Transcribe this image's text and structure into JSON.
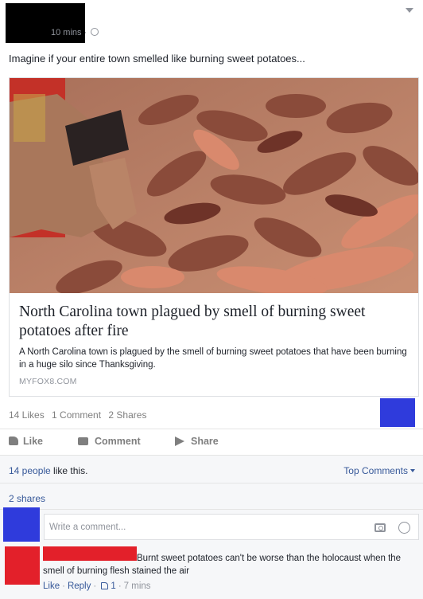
{
  "post": {
    "time": "10 mins",
    "text": "Imagine if your entire town smelled like burning sweet potatoes..."
  },
  "link": {
    "title": "North Carolina town plagued by smell of burning sweet potatoes after fire",
    "description": "A North Carolina town is plagued by the smell of burning sweet potatoes that have been burning in a huge silo since Thanksgiving.",
    "source": "MYFOX8.COM"
  },
  "stats": {
    "likes": "14 Likes",
    "comments": "1 Comment",
    "shares": "2 Shares"
  },
  "actions": {
    "like": "Like",
    "comment": "Comment",
    "share": "Share"
  },
  "summary": {
    "people_link": "14 people",
    "people_rest": " like this.",
    "top_comments": "Top Comments",
    "shares": "2 shares"
  },
  "comment_box": {
    "placeholder": "Write a comment..."
  },
  "comment": {
    "text": "Burnt sweet potatoes can't be worse than the holocaust when the smell of burning flesh stained the air",
    "like": "Like",
    "reply": "Reply",
    "like_count": "1",
    "time": "7 mins"
  },
  "colors": {
    "link_blue": "#365899",
    "redaction_black": "#000000",
    "redaction_blue": "#2f3bdc",
    "redaction_red": "#e3202a"
  },
  "icons": [
    "globe-icon",
    "chevron-down-icon",
    "like-icon",
    "comment-icon",
    "share-icon",
    "caret-icon",
    "camera-icon",
    "smiley-icon",
    "mini-like-icon"
  ]
}
